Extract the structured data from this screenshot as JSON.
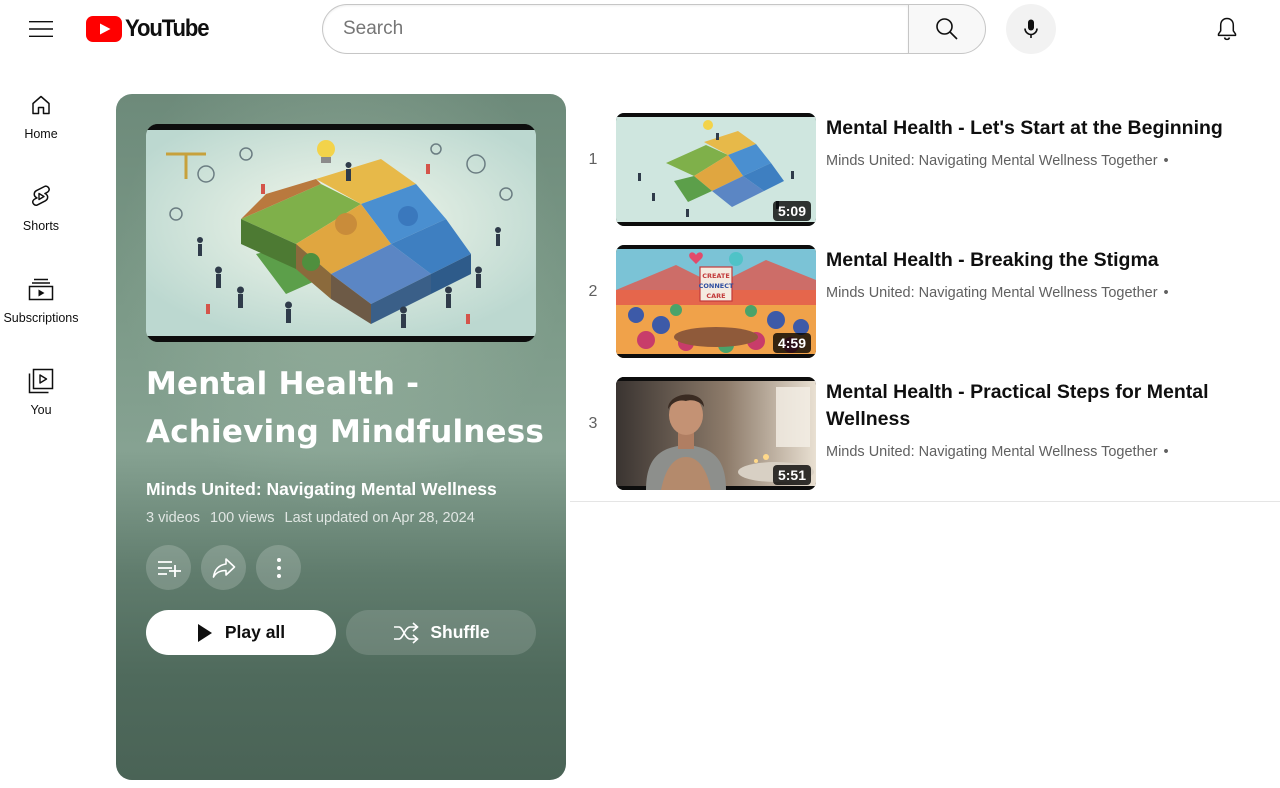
{
  "header": {
    "logo_text": "YouTube",
    "search_placeholder": "Search",
    "icons": {
      "menu": "hamburger-menu-icon",
      "search": "search-icon",
      "mic": "microphone-icon",
      "notifications": "bell-icon"
    },
    "brand_color": "#ff0000"
  },
  "guide": {
    "items": [
      {
        "label": "Home",
        "icon": "home-icon"
      },
      {
        "label": "Shorts",
        "icon": "shorts-icon"
      },
      {
        "label": "Subscriptions",
        "icon": "subscriptions-icon"
      },
      {
        "label": "You",
        "icon": "you-icon"
      }
    ]
  },
  "playlist": {
    "title": "Mental Health - Achieving Mindfulness",
    "owner": "Minds United: Navigating Mental Wellness",
    "stats": {
      "videos": "3 videos",
      "views": "100 views",
      "updated": "Last updated on Apr 28, 2024"
    },
    "actions": {
      "save_icon": "playlist-add-icon",
      "share_icon": "share-icon",
      "more_icon": "more-vert-icon"
    },
    "play_all_label": "Play all",
    "shuffle_label": "Shuffle",
    "card_color": "#5e7a6b"
  },
  "videos": [
    {
      "index": "1",
      "title": "Mental Health - Let's Start at the Beginning",
      "channel": "Minds United: Navigating Mental Wellness Together",
      "separator": "•",
      "duration": "5:09"
    },
    {
      "index": "2",
      "title": "Mental Health - Breaking the Stigma",
      "channel": "Minds United: Navigating Mental Wellness Together",
      "separator": "•",
      "duration": "4:59",
      "thumbnail_sign": [
        "CREATE",
        "CONNECT",
        "CARE"
      ]
    },
    {
      "index": "3",
      "title": "Mental Health - Practical Steps for Mental Wellness",
      "channel": "Minds United: Navigating Mental Wellness Together",
      "separator": "•",
      "duration": "5:51"
    }
  ]
}
